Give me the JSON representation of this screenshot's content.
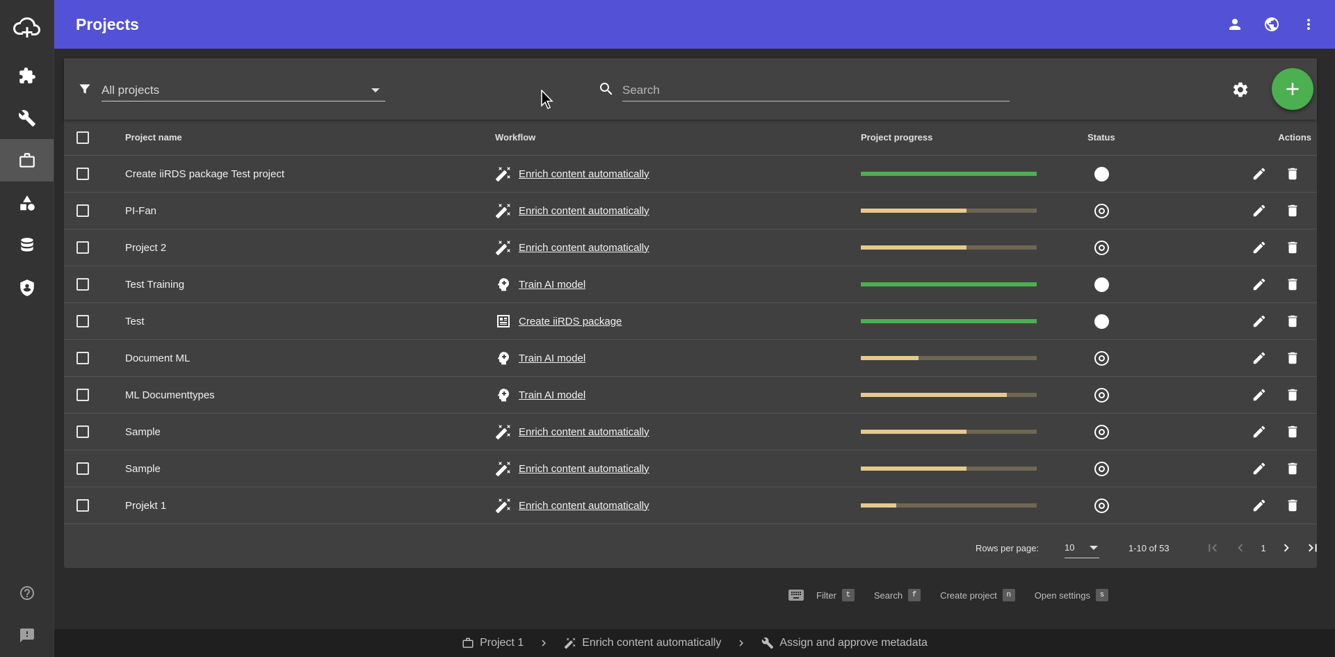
{
  "header": {
    "title": "Projects"
  },
  "sidebar": {
    "items": [
      {
        "name": "sidebar-item-plugins",
        "icon": "puzzle-icon"
      },
      {
        "name": "sidebar-item-tools",
        "icon": "wrench-icon"
      },
      {
        "name": "sidebar-item-projects",
        "icon": "briefcase-icon",
        "active": true
      },
      {
        "name": "sidebar-item-shapes",
        "icon": "shapes-icon"
      },
      {
        "name": "sidebar-item-database",
        "icon": "database-icon"
      },
      {
        "name": "sidebar-item-security",
        "icon": "shield-icon"
      }
    ]
  },
  "toolbar": {
    "filter_value": "All projects",
    "search_placeholder": "Search"
  },
  "table": {
    "headers": {
      "name": "Project name",
      "workflow": "Workflow",
      "progress": "Project progress",
      "status": "Status",
      "actions": "Actions"
    },
    "rows": [
      {
        "name": "Create iiRDS package Test project",
        "workflow": "Enrich content automatically",
        "wf_icon": "magic-wand-icon",
        "progress": 1.0,
        "status": "done"
      },
      {
        "name": "PI-Fan",
        "workflow": "Enrich content automatically",
        "wf_icon": "magic-wand-icon",
        "progress": 0.6,
        "status": "open"
      },
      {
        "name": "Project 2",
        "workflow": "Enrich content automatically",
        "wf_icon": "magic-wand-icon",
        "progress": 0.6,
        "status": "open"
      },
      {
        "name": "Test Training",
        "workflow": "Train AI model",
        "wf_icon": "brain-icon",
        "progress": 1.0,
        "status": "done"
      },
      {
        "name": "Test",
        "workflow": "Create iiRDS package",
        "wf_icon": "package-icon",
        "progress": 1.0,
        "status": "done"
      },
      {
        "name": "Document ML",
        "workflow": "Train AI model",
        "wf_icon": "brain-icon",
        "progress": 0.33,
        "status": "open"
      },
      {
        "name": "ML Documenttypes",
        "workflow": "Train AI model",
        "wf_icon": "brain-icon",
        "progress": 0.83,
        "status": "open"
      },
      {
        "name": "Sample",
        "workflow": "Enrich content automatically",
        "wf_icon": "magic-wand-icon",
        "progress": 0.6,
        "status": "open"
      },
      {
        "name": "Sample",
        "workflow": "Enrich content automatically",
        "wf_icon": "magic-wand-icon",
        "progress": 0.6,
        "status": "open"
      },
      {
        "name": "Projekt 1",
        "workflow": "Enrich content automatically",
        "wf_icon": "magic-wand-icon",
        "progress": 0.2,
        "status": "open"
      }
    ]
  },
  "pagination": {
    "rows_per_page_label": "Rows per page:",
    "rows_per_page": "10",
    "range": "1-10 of 53",
    "page": "1"
  },
  "shortcuts": [
    {
      "label": "Filter",
      "key": "t"
    },
    {
      "label": "Search",
      "key": "f"
    },
    {
      "label": "Create project",
      "key": "n"
    },
    {
      "label": "Open settings",
      "key": "s"
    }
  ],
  "breadcrumb": [
    {
      "label": "Project 1",
      "icon": "briefcase-icon"
    },
    {
      "label": "Enrich content automatically",
      "icon": "magic-wand-icon"
    },
    {
      "label": "Assign and approve metadata",
      "icon": "wrench-icon"
    }
  ],
  "colors": {
    "header": "#5351d6",
    "fab": "#4caf50",
    "progress_complete": "#4caf50",
    "progress_partial": "#e6c98d",
    "progress_track": "#6f6753"
  }
}
